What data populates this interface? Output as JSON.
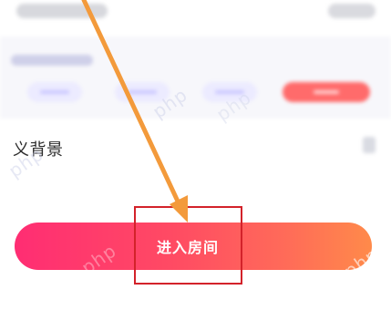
{
  "section": {
    "title_prefix": "",
    "title": "义背景"
  },
  "cta": {
    "label": "进入房间"
  },
  "watermark": {
    "text": "php"
  },
  "colors": {
    "cta_gradient_start": "#ff2d73",
    "cta_gradient_end": "#ff8a4a",
    "annotation_red": "#d3222a",
    "arrow_orange": "#f39a3b"
  },
  "icons": {
    "arrow": "arrow-down-icon"
  }
}
